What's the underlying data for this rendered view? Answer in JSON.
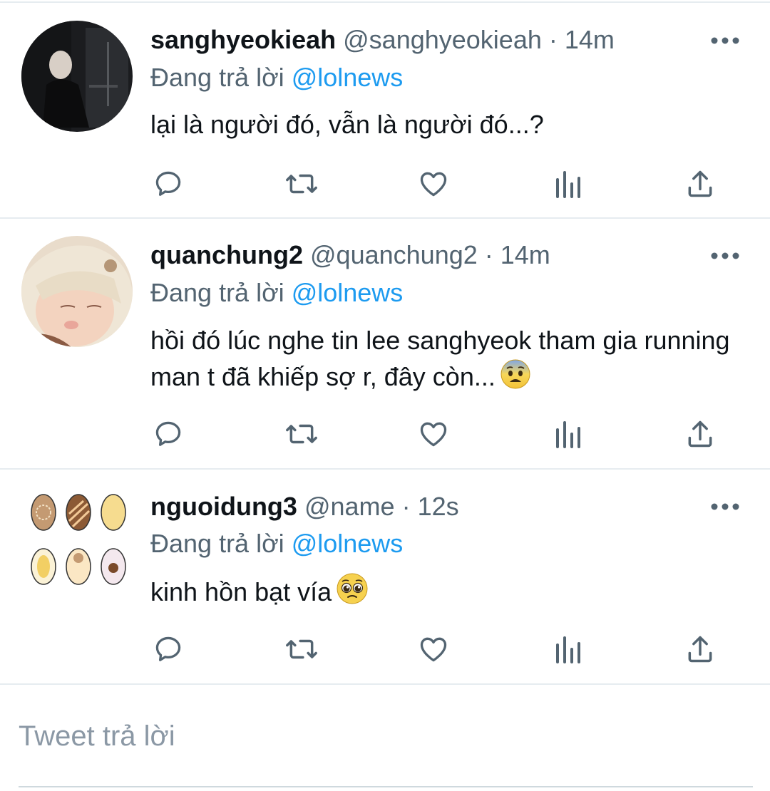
{
  "tweets": [
    {
      "username": "sanghyeokieah",
      "handle": "@sanghyeokieah",
      "sep": " · ",
      "time": "14m",
      "replying_prefix": "Đang trả lời ",
      "replying_to": "@lolnews",
      "text": "lại là người đó, vẫn là người đó...?",
      "emoji": ""
    },
    {
      "username": "quanchung2",
      "handle": "@quanchung2",
      "sep": " · ",
      "time": "14m",
      "replying_prefix": "Đang trả lời ",
      "replying_to": "@lolnews",
      "text": "hồi đó lúc nghe tin lee sanghyeok tham gia running man t đã khiếp sợ r, đây còn...",
      "emoji": "fearful-face"
    },
    {
      "username": "nguoidung3",
      "handle": "@name",
      "sep": " · ",
      "time": "12s",
      "replying_prefix": "Đang trả lời ",
      "replying_to": "@lolnews",
      "text": "kinh hồn bạt vía",
      "emoji": "pleading-face"
    }
  ],
  "reply_box": {
    "placeholder": "Tweet trả lời"
  },
  "icons": [
    "reply-icon",
    "retweet-icon",
    "like-icon",
    "analytics-icon",
    "share-icon",
    "more-icon"
  ],
  "colors": {
    "accent": "#1d9bf0",
    "text": "#0f1419",
    "muted": "#536471",
    "divider": "#e6ecf0"
  }
}
